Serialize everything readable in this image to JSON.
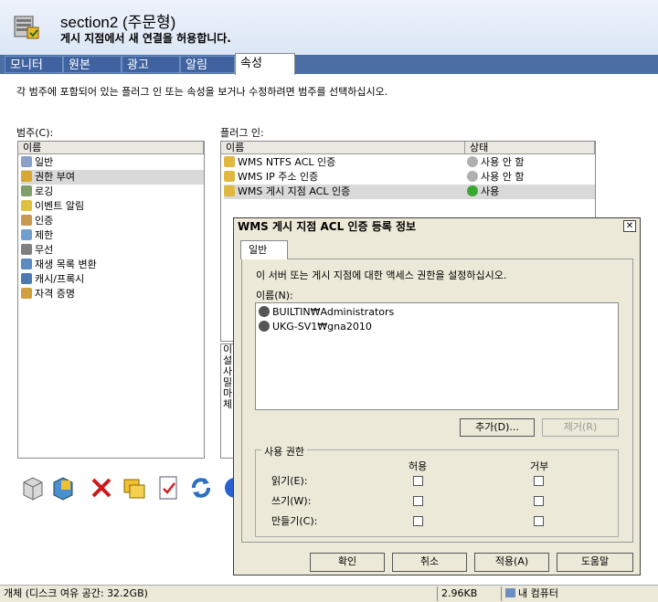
{
  "header": {
    "title": "section2 (주문형)",
    "subtitle": "게시 지점에서 새 연결을 허용합니다."
  },
  "tabs": [
    {
      "label": "모니터"
    },
    {
      "label": "원본"
    },
    {
      "label": "광고"
    },
    {
      "label": "알림"
    },
    {
      "label": "속성",
      "active": true
    }
  ],
  "instruction": "각 범주에 포함되어 있는 플러그 인 또는 속성을 보거나 수정하려면 범주를 선택하십시오.",
  "categories": {
    "label": "범주(C):",
    "column": "이름",
    "items": [
      {
        "label": "일반",
        "icon": "gear-icon"
      },
      {
        "label": "권한 부여",
        "icon": "lock-icon",
        "selected": true
      },
      {
        "label": "로깅",
        "icon": "log-icon"
      },
      {
        "label": "이벤트 알림",
        "icon": "event-icon"
      },
      {
        "label": "인증",
        "icon": "auth-icon"
      },
      {
        "label": "제한",
        "icon": "limit-icon"
      },
      {
        "label": "무선",
        "icon": "wireless-icon"
      },
      {
        "label": "재생 목록 변환",
        "icon": "playlist-icon"
      },
      {
        "label": "캐시/프록시",
        "icon": "cache-icon"
      },
      {
        "label": "자격 증명",
        "icon": "credential-icon"
      }
    ]
  },
  "plugins": {
    "label": "플러그 인:",
    "col_name": "이름",
    "col_status": "상태",
    "items": [
      {
        "name": "WMS NTFS ACL 인증",
        "status": "사용 안 함",
        "enabled": false
      },
      {
        "name": "WMS IP 주소 인증",
        "status": "사용 안 함",
        "enabled": false
      },
      {
        "name": "WMS 게시 지점 ACL 인증",
        "status": "사용",
        "enabled": true,
        "selected": true
      }
    ],
    "description_fragment": [
      "이",
      "설",
      "사",
      "밀",
      "마",
      "체"
    ]
  },
  "statusbar": {
    "disk": "개체 (디스크 여유 공간: 32.2GB)",
    "size": "2.96KB",
    "location": "내 컴퓨터"
  },
  "dialog": {
    "title": "WMS 게시 지점 ACL 인증 등록 정보",
    "close": "✕",
    "tab": "일반",
    "description": "이 서버 또는 게시 지점에 대한 액세스 권한을 설정하십시오.",
    "names_label": "이름(N):",
    "names": [
      "BUILTIN₩Administrators",
      "UKG-SV1₩gna2010"
    ],
    "add_button": "추가(D)...",
    "remove_button": "제거(R)",
    "perm_group_label": "사용 권한",
    "allow_header": "허용",
    "deny_header": "거부",
    "permissions": [
      {
        "label": "읽기(E):",
        "allow": false,
        "deny": false
      },
      {
        "label": "쓰기(W):",
        "allow": false,
        "deny": false
      },
      {
        "label": "만들기(C):",
        "allow": false,
        "deny": false
      }
    ],
    "ok_button": "확인",
    "cancel_button": "취소",
    "apply_button": "적용(A)",
    "help_button": "도움말"
  }
}
